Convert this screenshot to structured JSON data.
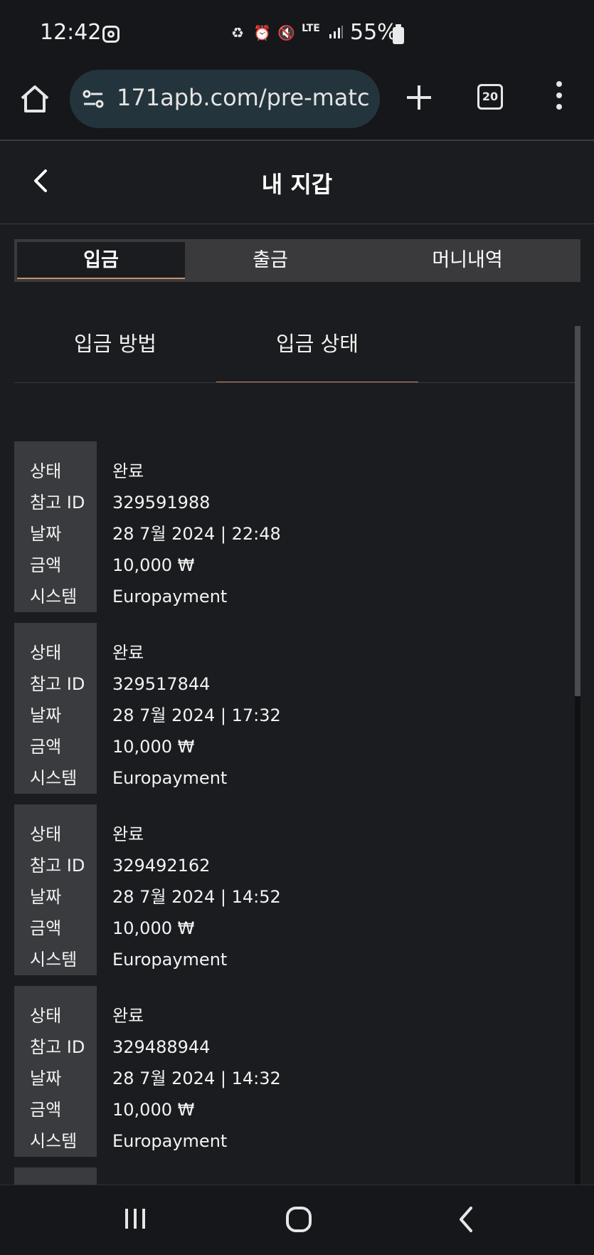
{
  "status_bar": {
    "time": "12:42",
    "network": "LTE",
    "battery": "55%"
  },
  "browser": {
    "url": "171apb.com/pre-matc",
    "tab_count": "20"
  },
  "header": {
    "title": "내 지갑"
  },
  "top_tabs": [
    {
      "label": "입금",
      "active": true
    },
    {
      "label": "출금",
      "active": false
    },
    {
      "label": "머니내역",
      "active": false
    }
  ],
  "sub_tabs": [
    {
      "label": "입금 방법",
      "active": false
    },
    {
      "label": "입금 상태",
      "active": true
    }
  ],
  "field_labels": {
    "status": "상태",
    "ref_id": "참고 ID",
    "date": "날짜",
    "amount": "금액",
    "system": "시스템"
  },
  "records": [
    {
      "status": "완료",
      "ref_id": "329591988",
      "date": "28 7월 2024 | 22:48",
      "amount": "10,000 ₩",
      "system": "Europayment"
    },
    {
      "status": "완료",
      "ref_id": "329517844",
      "date": "28 7월 2024 | 17:32",
      "amount": "10,000 ₩",
      "system": "Europayment"
    },
    {
      "status": "완료",
      "ref_id": "329492162",
      "date": "28 7월 2024 | 14:52",
      "amount": "10,000 ₩",
      "system": "Europayment"
    },
    {
      "status": "완료",
      "ref_id": "329488944",
      "date": "28 7월 2024 | 14:32",
      "amount": "10,000 ₩",
      "system": "Europayment"
    }
  ],
  "colors": {
    "background": "#1b1c1f",
    "label_column": "#3a3b3e",
    "accent_underline": "#b98564"
  }
}
